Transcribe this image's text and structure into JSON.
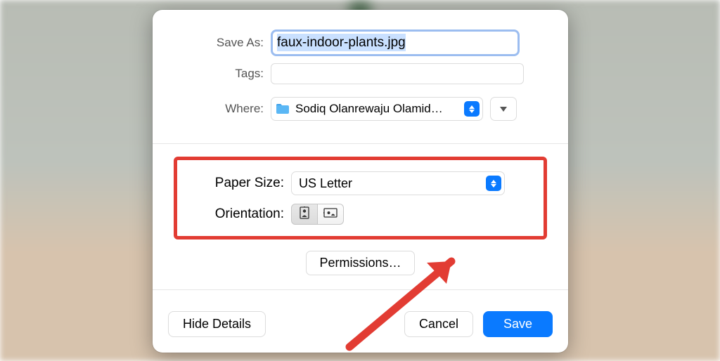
{
  "labels": {
    "save_as": "Save As:",
    "tags": "Tags:",
    "where": "Where:",
    "paper_size": "Paper Size:",
    "orientation": "Orientation:"
  },
  "fields": {
    "filename": "faux-indoor-plants.jpg",
    "tags_value": "",
    "where_folder": "Sodiq Olanrewaju Olamid…",
    "paper_size_value": "US Letter",
    "orientation": "portrait"
  },
  "buttons": {
    "permissions": "Permissions…",
    "hide_details": "Hide Details",
    "cancel": "Cancel",
    "save": "Save"
  }
}
